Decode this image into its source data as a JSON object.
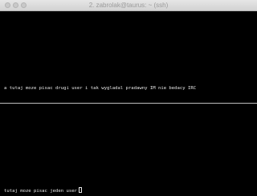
{
  "window": {
    "title": "2. zabrolak@taurus: ~ (ssh)"
  },
  "top_pane": {
    "text": "a tutaj moze pisac drugi user i tak wygladal pradawny IM nie bedacy IRC"
  },
  "bottom_pane": {
    "text": "tutaj moze pisac jeden user"
  },
  "colors": {
    "background": "#000000",
    "text": "#e6e6e6",
    "divider": "#bcbcbc",
    "titlebar": "#dcdcdc"
  }
}
